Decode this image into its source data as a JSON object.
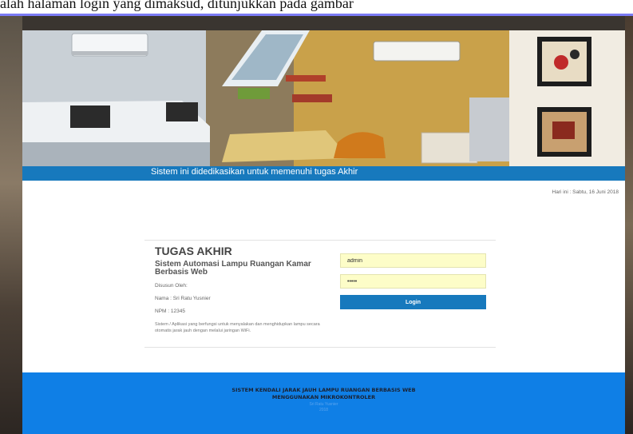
{
  "document": {
    "caption": "alah halaman login yang dimaksud, ditunjukkan pada gambar"
  },
  "header": {
    "tagline": "Sistem ini didedikasikan untuk memenuhi tugas Akhir"
  },
  "date": "Hari ini : Sabtu, 16 Juni 2018",
  "info": {
    "title": "TUGAS AKHIR",
    "subtitle": "Sistem Automasi Lampu Ruangan Kamar Berbasis Web",
    "author_label": "Disusun Oleh:",
    "name": "Nama : Sri Ratu Yusnier",
    "npm": "NPM : 12345",
    "description": "Sistem / Aplikasi yang berfungsi untuk menyalakan dan menghidupkan lampu secara otomatis jarak jauh dengan melalui jaringan WiFi."
  },
  "login": {
    "username_value": "admin",
    "password_value": "admin",
    "button_label": "Login"
  },
  "footer": {
    "title_line1": "SISTEM KENDALI JARAK JAUH LAMPU RUANGAN BERBASIS WEB",
    "title_line2": "MENGGUNAKAN MIKROKONTROLER",
    "sub_line1": "Sri Ratu Yusnier",
    "sub_line2": "2018"
  },
  "colors": {
    "primary": "#1779bd",
    "footer": "#0f7fe6",
    "input_bg": "#fdfdc8",
    "caption_rule": "#7b7bf5"
  }
}
